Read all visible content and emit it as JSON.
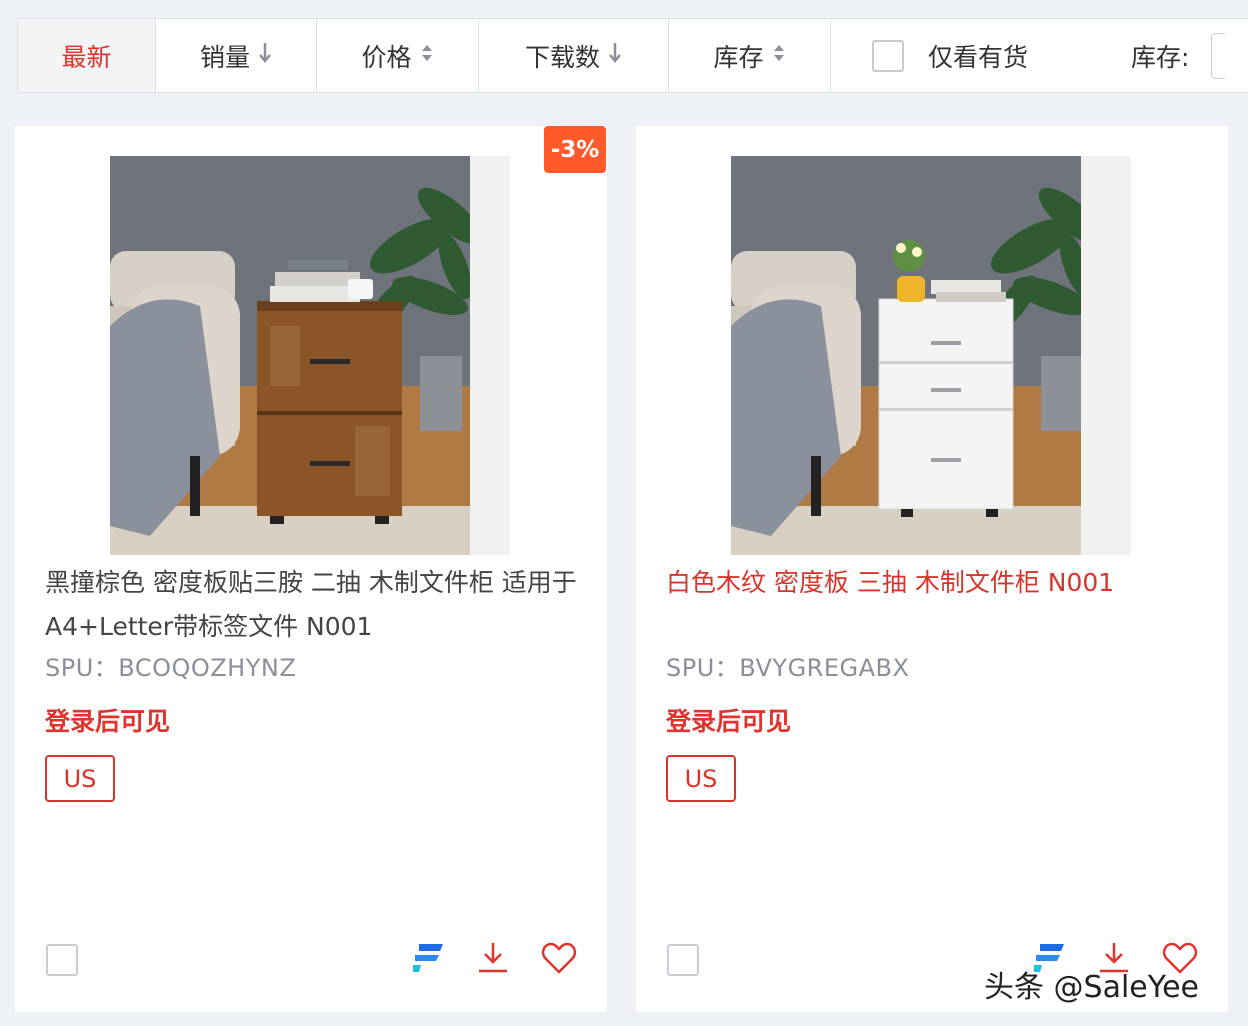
{
  "sortbar": {
    "items": [
      {
        "label": "最新",
        "arrow": ""
      },
      {
        "label": "销量",
        "arrow": "⬇"
      },
      {
        "label": "价格",
        "arrow": "⬍"
      },
      {
        "label": "下载数",
        "arrow": "⬇"
      },
      {
        "label": "库存",
        "arrow": "⬍"
      }
    ],
    "stock_only_label": "仅看有货",
    "stock_label": "库存:"
  },
  "products": [
    {
      "discount": "-3%",
      "title": "黑撞棕色 密度板贴三胺 二抽 木制文件柜 适用于A4+Letter带标签文件 N001",
      "spu": "SPU：BCOQOZHYNZ",
      "login_text": "登录后可见",
      "region": "US"
    },
    {
      "discount": "",
      "title": "白色木纹 密度板 三抽 木制文件柜 N001",
      "spu": "SPU：BVYGREGABX",
      "login_text": "登录后可见",
      "region": "US"
    }
  ],
  "watermark": "头条 @SaleYee",
  "colors": {
    "accent_red": "#e0332d",
    "discount_orange": "#ff5b2a",
    "logo_blue": "#1e6be6"
  },
  "icons": {
    "logo": "f-brand-icon",
    "download": "download-icon",
    "favorite": "heart-icon"
  }
}
